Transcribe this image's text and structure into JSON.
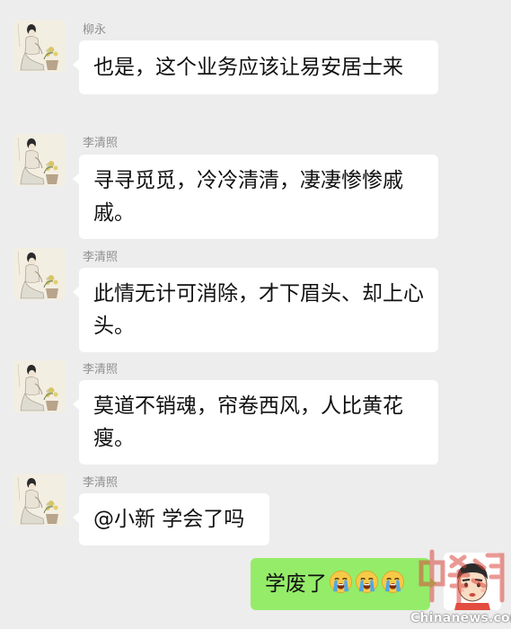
{
  "messages": [
    {
      "sender": "柳永",
      "avatar": "ink-painting-avatar",
      "text": "也是，这个业务应该让易安居士来"
    },
    {
      "sender": "李清照",
      "avatar": "ink-painting-avatar",
      "text": "寻寻觅觅，冷冷清清，凄凄惨惨戚戚。"
    },
    {
      "sender": "李清照",
      "avatar": "ink-painting-avatar",
      "text": "此情无计可消除，才下眉头、却上心头。"
    },
    {
      "sender": "李清照",
      "avatar": "ink-painting-avatar",
      "text": "莫道不销魂，帘卷西风，人比黄花瘦。"
    },
    {
      "sender": "李清照",
      "avatar": "ink-painting-avatar",
      "text": "@小新 学会了吗"
    }
  ],
  "outgoing": {
    "text": "学废了",
    "emojis": [
      "crying-face-emoji",
      "crying-face-emoji",
      "crying-face-emoji"
    ],
    "avatar": "cartoon-boy-avatar"
  },
  "watermark": {
    "text": "Chinanews.com",
    "seal": "中新网"
  },
  "colors": {
    "background": "#ededed",
    "incoming_bubble": "#ffffff",
    "outgoing_bubble": "#95ec69",
    "sender_name": "#8f8f8f"
  }
}
